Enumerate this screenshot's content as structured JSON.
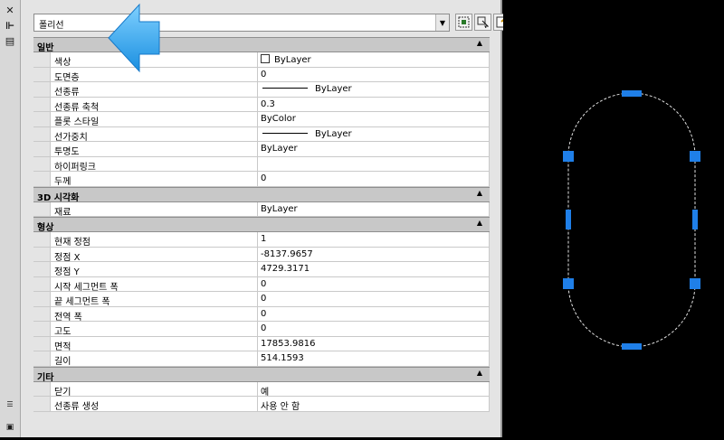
{
  "object_type": "폴리선",
  "sections": [
    {
      "title": "일반",
      "rows": [
        {
          "label": "색상",
          "value": "ByLayer",
          "swatch": true
        },
        {
          "label": "도면층",
          "value": "0"
        },
        {
          "label": "선종류",
          "value": "ByLayer",
          "line": true
        },
        {
          "label": "선종류 축척",
          "value": "0.3"
        },
        {
          "label": "플롯 스타일",
          "value": "ByColor"
        },
        {
          "label": "선가중치",
          "value": "ByLayer",
          "line": true
        },
        {
          "label": "투명도",
          "value": "ByLayer"
        },
        {
          "label": "하이퍼링크",
          "value": ""
        },
        {
          "label": "두께",
          "value": "0"
        }
      ]
    },
    {
      "title": "3D 시각화",
      "rows": [
        {
          "label": "재료",
          "value": "ByLayer"
        }
      ]
    },
    {
      "title": "형상",
      "rows": [
        {
          "label": "현재 정점",
          "value": "1"
        },
        {
          "label": "정점 X",
          "value": "-8137.9657"
        },
        {
          "label": "정점 Y",
          "value": "4729.3171"
        },
        {
          "label": "시작 세그먼트 폭",
          "value": "0"
        },
        {
          "label": "끝 세그먼트 폭",
          "value": "0"
        },
        {
          "label": "전역 폭",
          "value": "0"
        },
        {
          "label": "고도",
          "value": "0"
        },
        {
          "label": "면적",
          "value": "17853.9816"
        },
        {
          "label": "길이",
          "value": "514.1593"
        }
      ]
    },
    {
      "title": "기타",
      "rows": [
        {
          "label": "닫기",
          "value": "예"
        },
        {
          "label": "선종류 생성",
          "value": "사용 안 함"
        }
      ]
    }
  ],
  "colors": {
    "grip": "#1f7fe8",
    "arrow": "#3aa8f0",
    "drawing_bg": "#000000"
  }
}
